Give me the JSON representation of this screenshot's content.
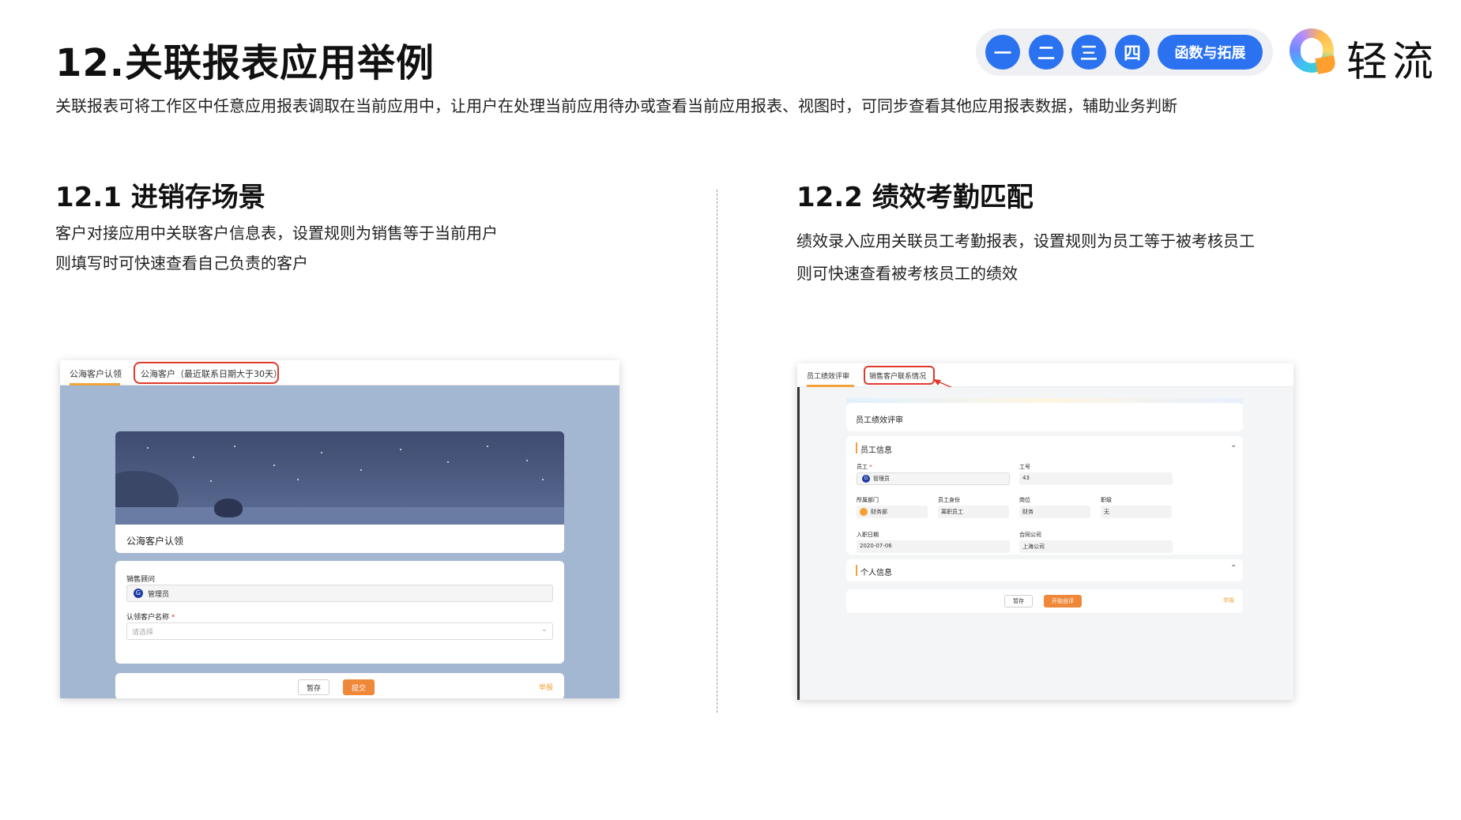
{
  "header": {
    "title": "12.关联报表应用举例",
    "description": "关联报表可将工作区中任意应用报表调取在当前应用中，让用户在处理当前应用待办或查看当前应用报表、视图时，可同步查看其他应用报表数据，辅助业务判断"
  },
  "nav": {
    "items": [
      "一",
      "二",
      "三",
      "四"
    ],
    "extra": "函数与拓展",
    "accent": "#2a72f0"
  },
  "logo": {
    "text": "轻流"
  },
  "left": {
    "title": "12.1 进销存场景",
    "line1": "客户对接应用中关联客户信息表，设置规则为销售等于当前用户",
    "line2": "则填写时可快速查看自己负责的客户",
    "screenshot": {
      "tab1": "公海客户认领",
      "tab2": "公海客户（最近联系日期大于30天）",
      "form_title": "公海客户认领",
      "field1_label": "销售顾问",
      "field1_value": "管理员",
      "field2_label": "认领客户名称",
      "field2_required": "*",
      "field2_placeholder": "请选择",
      "btn_save": "暂存",
      "btn_submit": "提交",
      "link": "举报"
    }
  },
  "right": {
    "title": "12.2 绩效考勤匹配",
    "line1": "绩效录入应用关联员工考勤报表，设置规则为员工等于被考核员工",
    "line2": "则可快速查看被考核员工的绩效",
    "screenshot": {
      "tab1": "员工绩效评审",
      "tab2": "销售客户联系情况",
      "form_title": "员工绩效评审",
      "section1": "员工信息",
      "employee_label": "员工",
      "employee_required": "*",
      "employee_value": "管理员",
      "id_label": "工号",
      "id_value": "43",
      "dept_label": "所属部门",
      "dept_value": "财务部",
      "identity_label": "员工身份",
      "identity_value": "离职员工",
      "post_label": "岗位",
      "post_value": "财务",
      "rank_label": "职级",
      "rank_value": "无",
      "hire_label": "入职日期",
      "hire_value": "2020-07-06",
      "company_label": "合同公司",
      "company_value": "上海公司",
      "section2": "个人信息",
      "btn_save": "暂存",
      "btn_start": "开始自评",
      "link": "举报"
    }
  }
}
